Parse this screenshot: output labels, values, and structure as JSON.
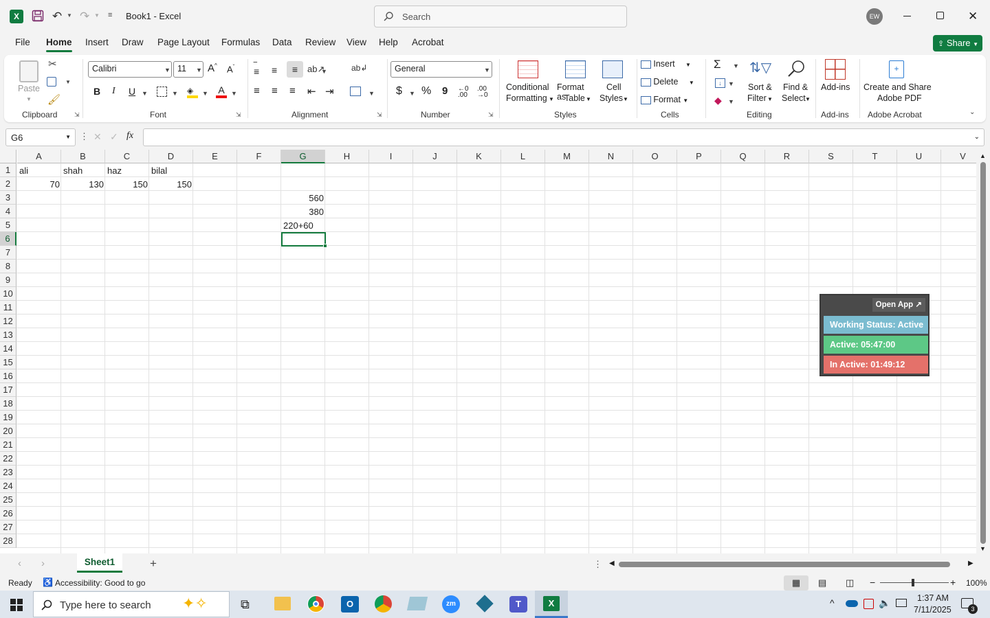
{
  "titlebar": {
    "doc_title": "Book1 - Excel",
    "search_placeholder": "Search",
    "user_initials": "EW"
  },
  "tabs": [
    "File",
    "Home",
    "Insert",
    "Draw",
    "Page Layout",
    "Formulas",
    "Data",
    "Review",
    "View",
    "Help",
    "Acrobat"
  ],
  "share_label": "Share",
  "ribbon": {
    "clipboard": {
      "paste": "Paste",
      "label": "Clipboard"
    },
    "font": {
      "name": "Calibri",
      "size": "11",
      "label": "Font",
      "bold": "B",
      "italic": "I",
      "underline": "U"
    },
    "alignment": {
      "label": "Alignment"
    },
    "number": {
      "format": "General",
      "label": "Number",
      "currency": "$",
      "percent": "%",
      "comma": "9"
    },
    "styles": {
      "conditional_1": "Conditional",
      "conditional_2": "Formatting",
      "format_table_1": "Format as",
      "format_table_2": "Table",
      "cell_styles_1": "Cell",
      "cell_styles_2": "Styles",
      "label": "Styles"
    },
    "cells": {
      "insert": "Insert",
      "delete": "Delete",
      "format": "Format",
      "label": "Cells"
    },
    "editing": {
      "sort_1": "Sort &",
      "sort_2": "Filter",
      "find_1": "Find &",
      "find_2": "Select",
      "label": "Editing"
    },
    "addins": {
      "addins": "Add-ins",
      "label": "Add-ins"
    },
    "acrobat": {
      "create_1": "Create and Share",
      "create_2": "Adobe PDF",
      "label": "Adobe Acrobat"
    }
  },
  "formula_bar": {
    "name_box": "G6",
    "fx": "fx",
    "formula": ""
  },
  "columns": [
    "A",
    "B",
    "C",
    "D",
    "E",
    "F",
    "G",
    "H",
    "I",
    "J",
    "K",
    "L",
    "M",
    "N",
    "O",
    "P",
    "Q",
    "R",
    "S",
    "T",
    "U",
    "V"
  ],
  "rows": [
    "1",
    "2",
    "3",
    "4",
    "5",
    "6",
    "7",
    "8",
    "9",
    "10",
    "11",
    "12",
    "13",
    "14",
    "15",
    "16",
    "17",
    "18",
    "19",
    "20",
    "21",
    "22",
    "23",
    "24",
    "25",
    "26",
    "27",
    "28"
  ],
  "cells": {
    "A1": "ali",
    "B1": "shah",
    "C1": "haz",
    "D1": "bilal",
    "A2": "70",
    "B2": "130",
    "C2": "150",
    "D2": "150",
    "G3": "560",
    "G4": "380",
    "G5": "220+60"
  },
  "selected_cell": "G6",
  "widget": {
    "open_app": "Open App ↗",
    "working_status": "Working Status: Active",
    "active": "Active: 05:47:00",
    "inactive": "In Active: 01:49:12",
    "colors": {
      "status": "#7bbcd0",
      "active": "#5dc886",
      "inactive": "#e4716a"
    }
  },
  "sheets": {
    "active": "Sheet1"
  },
  "status": {
    "ready": "Ready",
    "accessibility": "Accessibility: Good to go",
    "zoom": "100%"
  },
  "taskbar": {
    "search_placeholder": "Type here to search",
    "time": "1:37 AM",
    "date": "7/11/2025",
    "notifications": "3"
  },
  "colors": {
    "excel_green": "#137a3d",
    "share_button": "#107c41"
  }
}
